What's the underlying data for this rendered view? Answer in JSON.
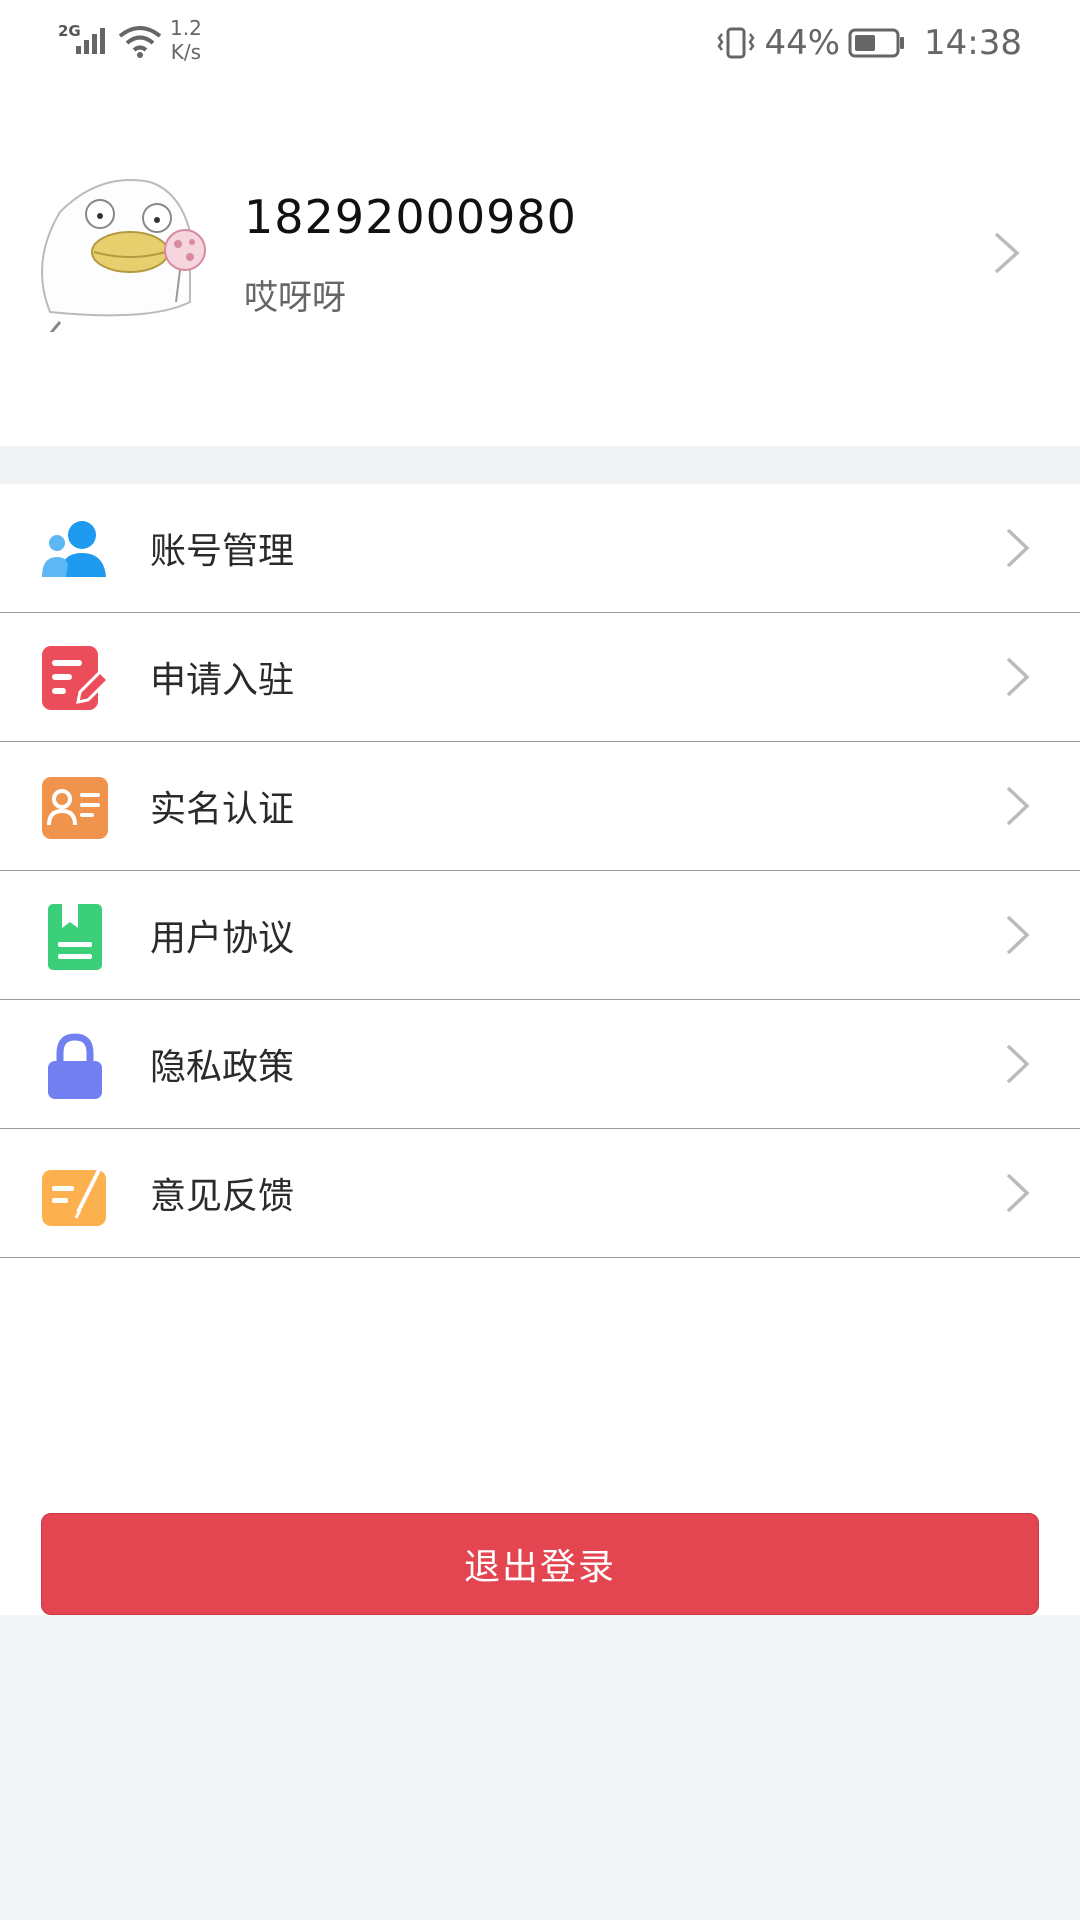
{
  "status_bar": {
    "network": "2G",
    "speed_value": "1.2",
    "speed_unit": "K/s",
    "battery_percent": "44%",
    "time": "14:38"
  },
  "profile": {
    "phone": "18292000980",
    "nickname": "哎呀呀"
  },
  "menu": {
    "items": [
      {
        "label": "账号管理",
        "icon": "account-icon",
        "color": "#1e9af0"
      },
      {
        "label": "申请入驻",
        "icon": "apply-icon",
        "color": "#ec4d5a"
      },
      {
        "label": "实名认证",
        "icon": "id-card-icon",
        "color": "#f0934c"
      },
      {
        "label": "用户协议",
        "icon": "agreement-icon",
        "color": "#3ccf7a"
      },
      {
        "label": "隐私政策",
        "icon": "lock-icon",
        "color": "#717ff0"
      },
      {
        "label": "意见反馈",
        "icon": "feedback-icon",
        "color": "#fcb14e"
      }
    ]
  },
  "logout_label": "退出登录",
  "colors": {
    "accent": "#e34551",
    "background": "#f3f4f6"
  }
}
